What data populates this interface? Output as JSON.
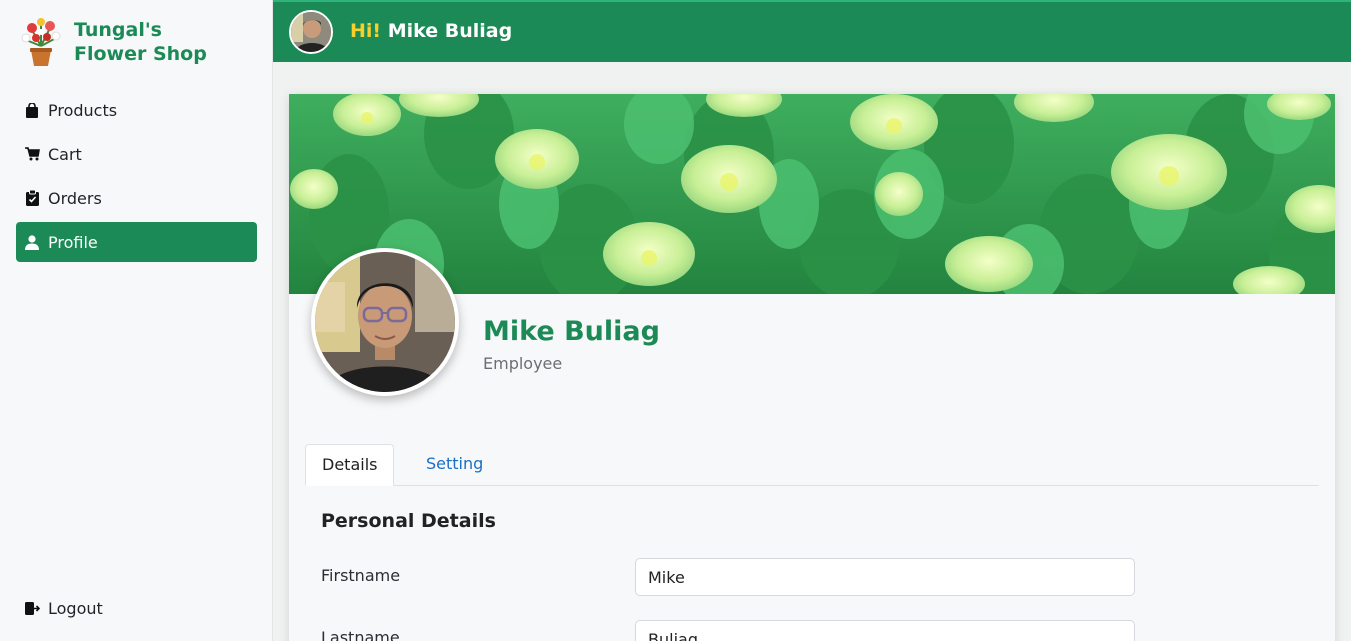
{
  "brand": {
    "name": "Tungal's Flower Shop",
    "logo_icon": "flower-pot-icon"
  },
  "sidebar": {
    "items": [
      {
        "label": "Products",
        "icon": "shopping-bag-icon",
        "active": false
      },
      {
        "label": "Cart",
        "icon": "cart-icon",
        "active": false
      },
      {
        "label": "Orders",
        "icon": "clipboard-icon",
        "active": false
      },
      {
        "label": "Profile",
        "icon": "user-icon",
        "active": true
      }
    ],
    "logout_label": "Logout",
    "logout_icon": "logout-icon"
  },
  "header": {
    "hi": "Hi!",
    "user_name": "Mike Buliag"
  },
  "profile": {
    "name": "Mike Buliag",
    "role": "Employee"
  },
  "tabs": [
    {
      "label": "Details",
      "active": true
    },
    {
      "label": "Setting",
      "active": false
    }
  ],
  "details": {
    "section_title": "Personal Details",
    "fields": [
      {
        "label": "Firstname",
        "value": "Mike"
      },
      {
        "label": "Lastname",
        "value": "Buliag"
      }
    ]
  },
  "colors": {
    "primary": "#1b8a56",
    "accent": "#f7d02c",
    "link": "#1a6fc4"
  }
}
